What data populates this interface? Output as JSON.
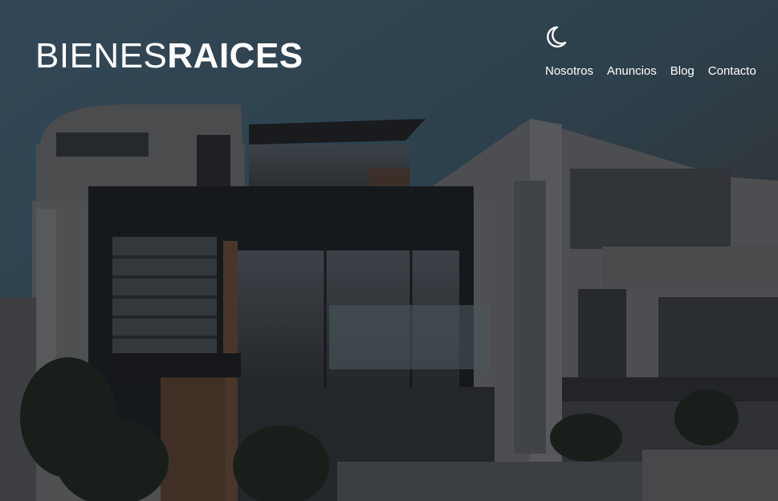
{
  "header": {
    "logo": {
      "light": "BIENES",
      "bold": "RAICES"
    },
    "dark_mode_icon": "moon-icon",
    "nav": [
      {
        "label": "Nosotros"
      },
      {
        "label": "Anuncios"
      },
      {
        "label": "Blog"
      },
      {
        "label": "Contacto"
      }
    ]
  },
  "colors": {
    "text": "#ffffff",
    "sky_overlay": "#3a4f5f",
    "dark_overlay": "#3a3b3e"
  }
}
